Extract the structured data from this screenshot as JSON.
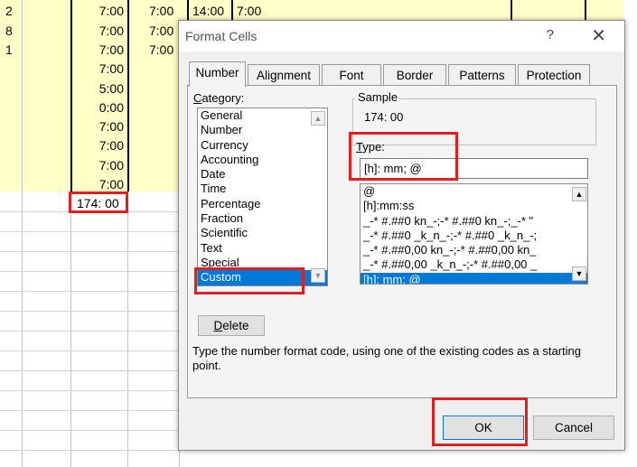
{
  "sheet": {
    "row_ids": [
      "2",
      "8",
      "1"
    ],
    "col_b_values": [
      "7:00",
      "7:00",
      "7:00",
      "7:00",
      "5:00",
      "0:00",
      "7:00",
      "7:00",
      "7:00",
      "7:00"
    ],
    "col_c_values": [
      "7:00",
      "7:00",
      "7:00"
    ],
    "col_d_value": "14:00",
    "col_e_value": "7:00",
    "total_value": "174: 00"
  },
  "dialog": {
    "title": "Format Cells",
    "help_label": "?",
    "close_label": "✕",
    "tabs": [
      "Number",
      "Alignment",
      "Font",
      "Border",
      "Patterns",
      "Protection"
    ],
    "active_tab": "Number",
    "category_label": "Category:",
    "categories": [
      "General",
      "Number",
      "Currency",
      "Accounting",
      "Date",
      "Time",
      "Percentage",
      "Fraction",
      "Scientific",
      "Text",
      "Special",
      "Custom"
    ],
    "selected_category": "Custom",
    "sample_label": "Sample",
    "sample_value": "174: 00",
    "type_label": "Type:",
    "type_value": "[h]: mm; @",
    "format_codes": [
      "@",
      "[h]:mm:ss",
      "_-* #.##0 kn_-;-* #.##0 kn_-;_-* \"",
      "_-* #.##0 _k_n_-;-* #.##0 _k_n_-;",
      "_-* #.##0,00 kn_-;-* #.##0,00 kn_",
      "_-* #.##0,00 _k_n_-;-* #.##0,00 _",
      "[h]: mm; @"
    ],
    "selected_format": "[h]: mm; @",
    "delete_label": "Delete",
    "help_text": "Type the number format code, using one of the existing codes as a starting point.",
    "ok_label": "OK",
    "cancel_label": "Cancel",
    "colors": {
      "highlight": "#e02020",
      "selection": "#0078d7",
      "cell_fill": "#ffffc8"
    }
  }
}
